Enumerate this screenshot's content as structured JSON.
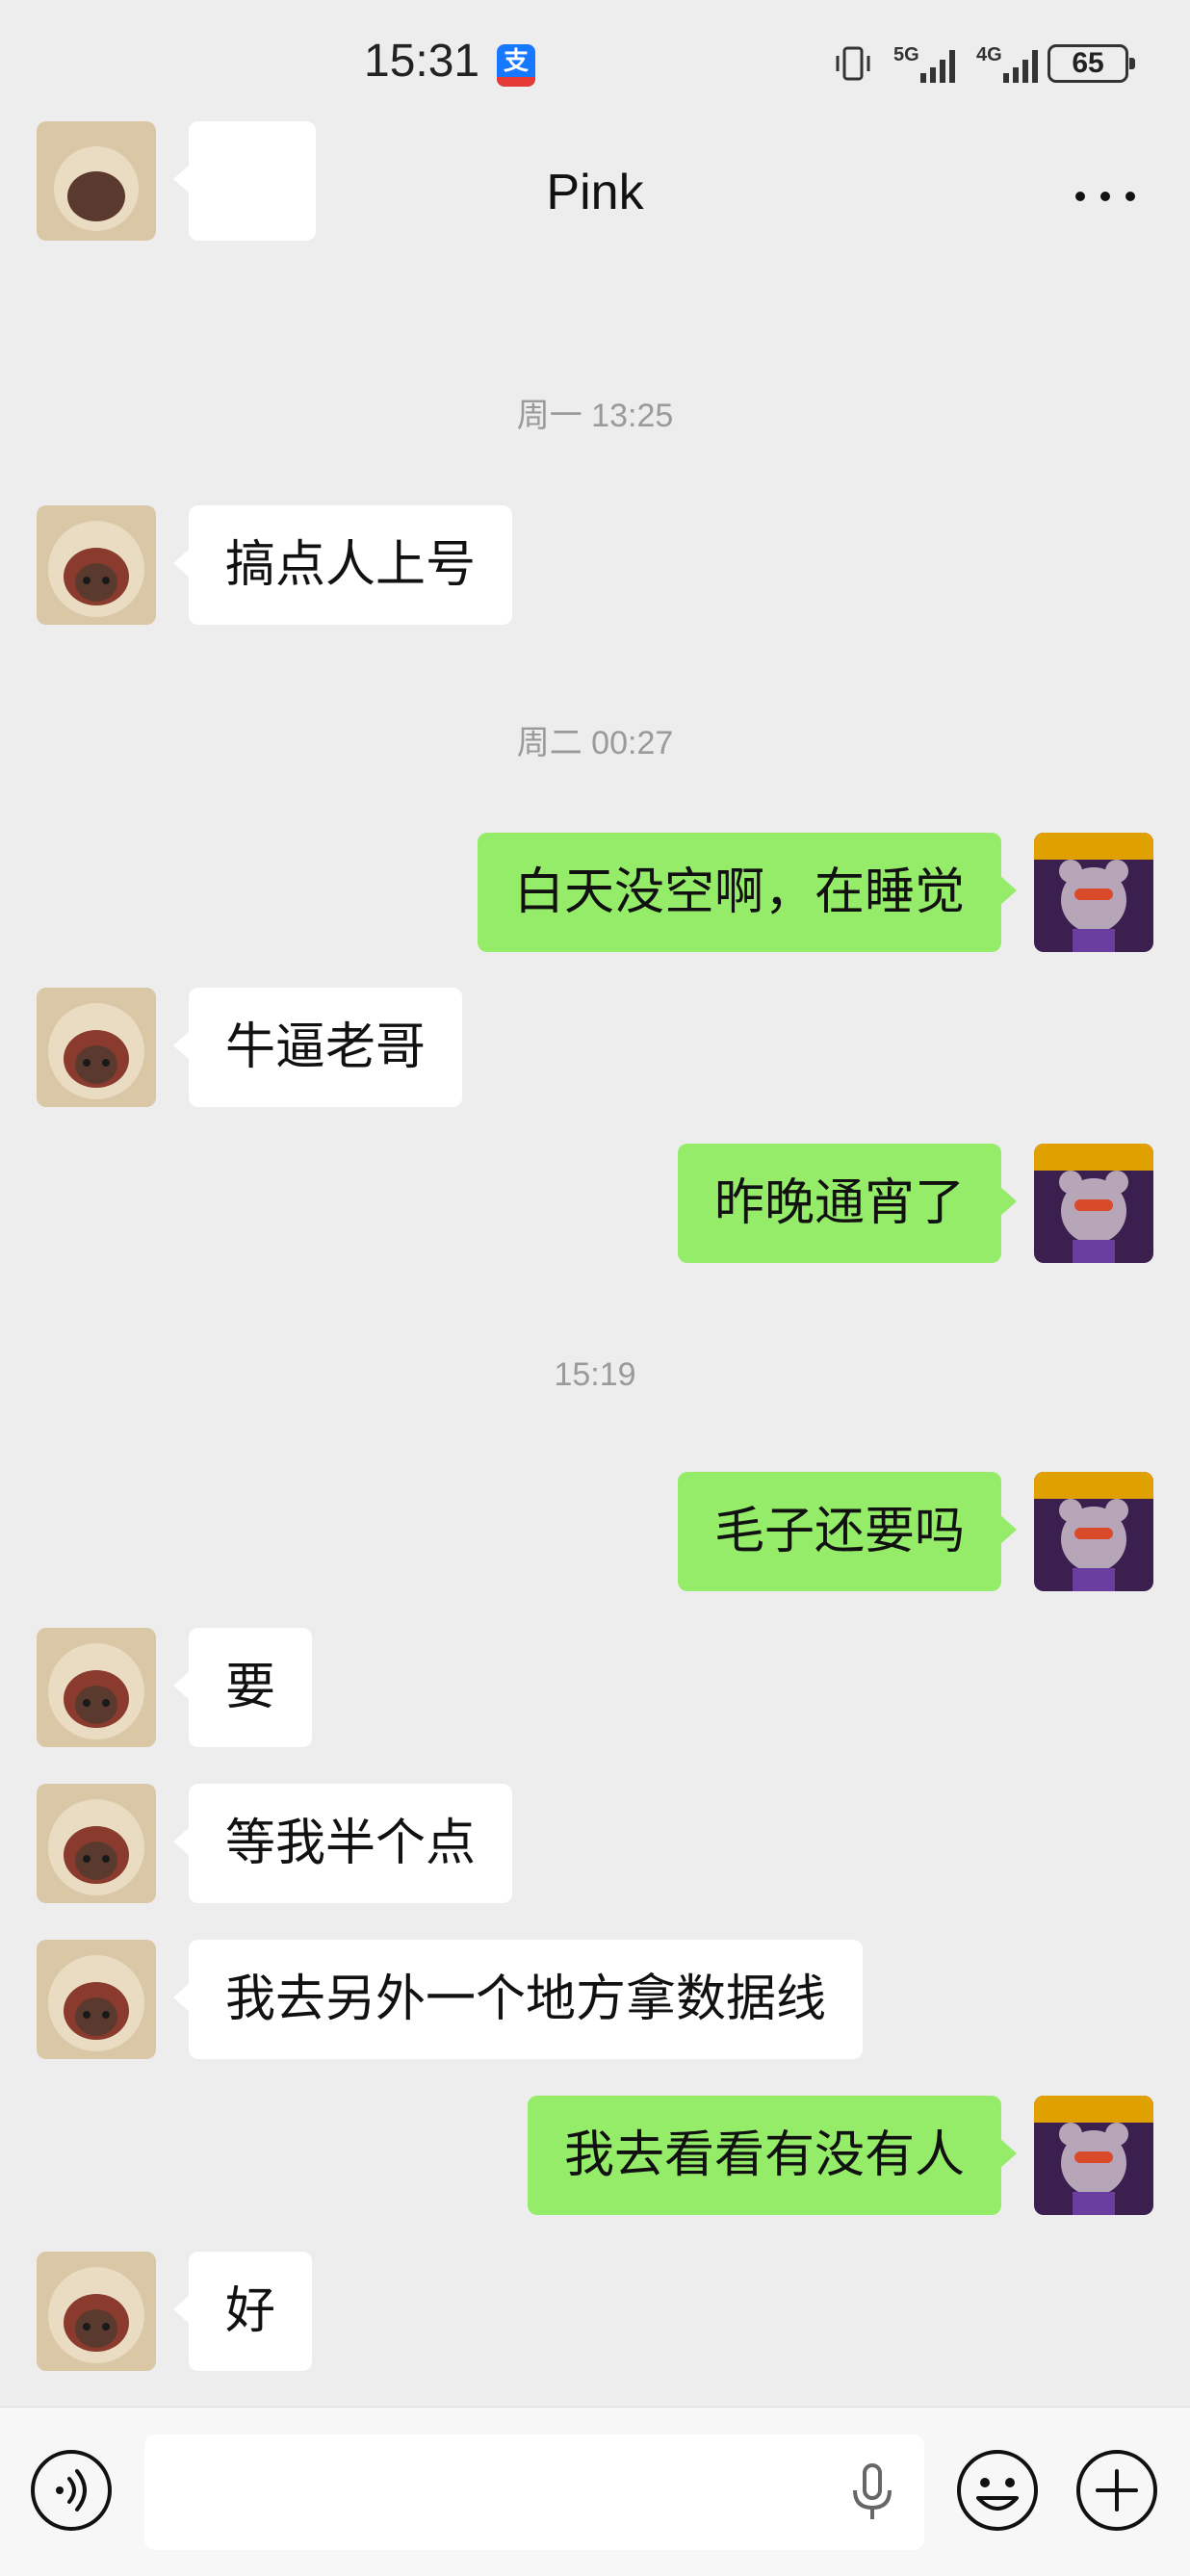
{
  "status_bar": {
    "time": "15:31",
    "app_badge": "支",
    "net_5g": "5G",
    "net_4g": "4G",
    "battery": "65"
  },
  "header": {
    "title": "Pink"
  },
  "timestamps": [
    "周一 13:25",
    "周二 00:27",
    "15:19"
  ],
  "messages": [
    {
      "side": "left",
      "text": "搞点人上号"
    },
    {
      "side": "right",
      "text": "白天没空啊，在睡觉"
    },
    {
      "side": "left",
      "text": "牛逼老哥"
    },
    {
      "side": "right",
      "text": "昨晚通宵了"
    },
    {
      "side": "right",
      "text": "毛子还要吗"
    },
    {
      "side": "left",
      "text": "要"
    },
    {
      "side": "left",
      "text": "等我半个点"
    },
    {
      "side": "left",
      "text": "我去另外一个地方拿数据线"
    },
    {
      "side": "right",
      "text": "我去看看有没有人"
    },
    {
      "side": "left",
      "text": "好"
    }
  ],
  "input": {
    "placeholder": ""
  },
  "colors": {
    "background": "#ededed",
    "sent_bubble": "#95ec69",
    "received_bubble": "#ffffff",
    "timestamp": "#9a9a9a"
  },
  "icons": [
    "back-arrow-icon",
    "more-dots-icon",
    "voice-icon",
    "mic-icon",
    "emoji-icon",
    "plus-icon",
    "vibrate-icon",
    "signal-icon",
    "battery-icon",
    "alipay-icon"
  ]
}
